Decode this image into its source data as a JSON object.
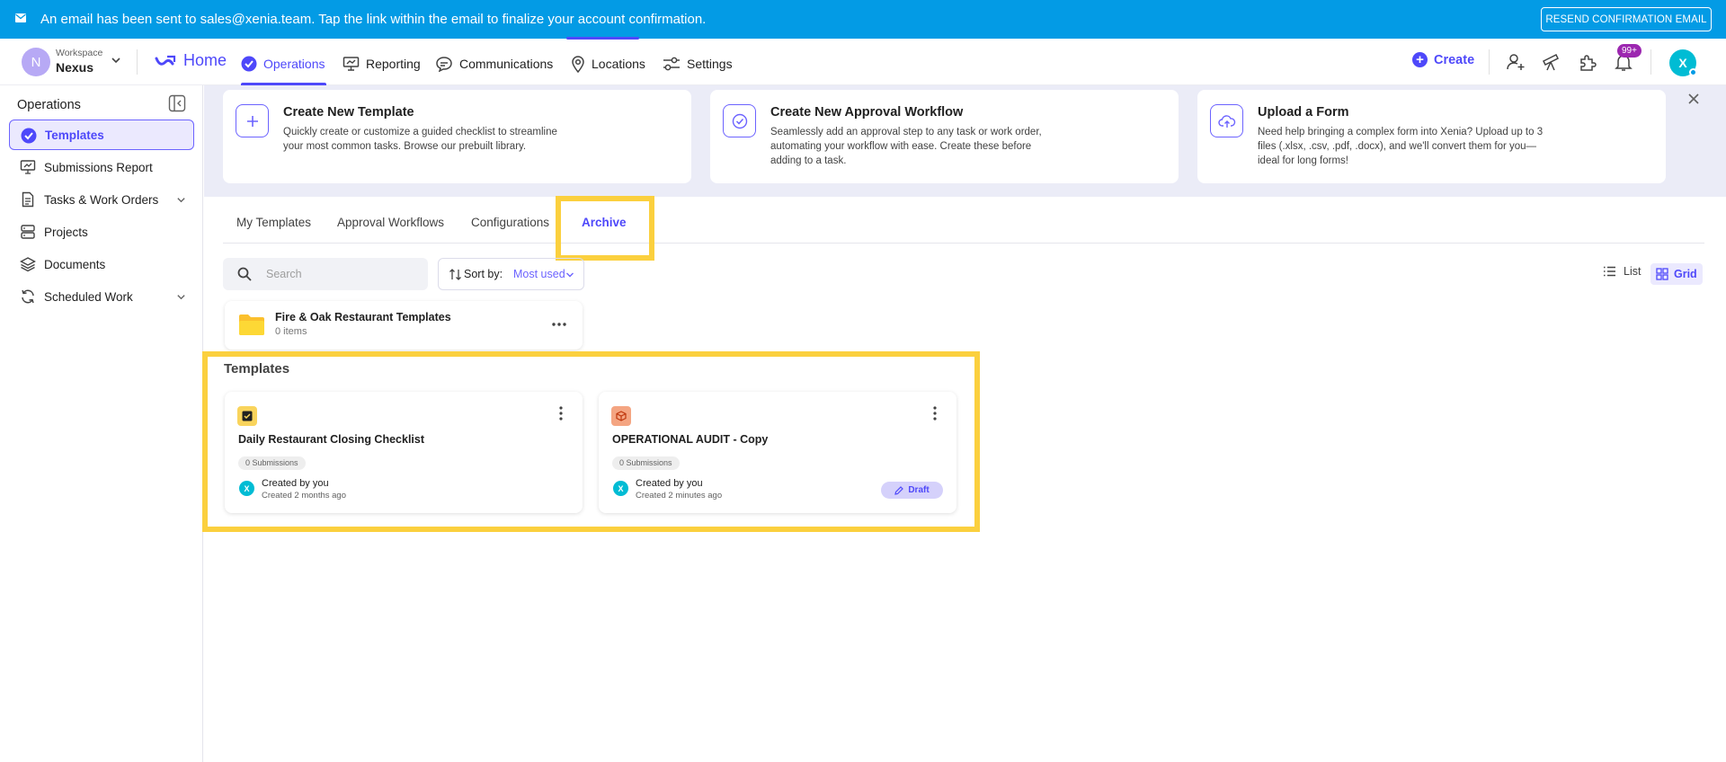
{
  "banner": {
    "message": "An email has been sent to sales@xenia.team. Tap the link within the email to finalize your account confirmation.",
    "resend_label": "RESEND CONFIRMATION EMAIL"
  },
  "workspace": {
    "avatar_letter": "N",
    "label": "Workspace",
    "name": "Nexus"
  },
  "nav": {
    "home": "Home",
    "items": [
      {
        "label": "Operations",
        "icon": "check-circle-icon",
        "active": true
      },
      {
        "label": "Reporting",
        "icon": "presentation-chart-icon"
      },
      {
        "label": "Communications",
        "icon": "chat-bubble-icon"
      },
      {
        "label": "Locations",
        "icon": "map-pin-icon"
      },
      {
        "label": "Settings",
        "icon": "sliders-icon"
      }
    ],
    "create": "Create",
    "notifications_badge": "99+",
    "user_initial": "X"
  },
  "sidebar": {
    "title": "Operations",
    "items": [
      {
        "label": "Templates",
        "icon": "check-circle-icon",
        "active": true
      },
      {
        "label": "Submissions Report",
        "icon": "presentation-icon"
      },
      {
        "label": "Tasks & Work Orders",
        "icon": "document-icon",
        "expandable": true
      },
      {
        "label": "Projects",
        "icon": "stack-icon"
      },
      {
        "label": "Documents",
        "icon": "layers-icon"
      },
      {
        "label": "Scheduled Work",
        "icon": "refresh-icon",
        "expandable": true
      }
    ]
  },
  "hero": {
    "cards": [
      {
        "title": "Create New Template",
        "desc1": "Quickly create or customize a guided checklist to streamline",
        "desc2": "your most common tasks. Browse our prebuilt library.",
        "desc3": ""
      },
      {
        "title": "Create New Approval Workflow",
        "desc1": "Seamlessly add an approval step to any task or work order,",
        "desc2": "automating your workflow with ease. Create these before",
        "desc3": "adding to a task."
      },
      {
        "title": "Upload a Form",
        "desc1": "Need help bringing a complex form into Xenia? Upload up to 3",
        "desc2": "files (.xlsx, .csv, .pdf, .docx), and we'll convert them for you—",
        "desc3": "ideal for long forms!"
      }
    ]
  },
  "tabs": [
    "My Templates",
    "Approval Workflows",
    "Configurations",
    "Archive"
  ],
  "toolbar": {
    "search_placeholder": "Search",
    "sort_label": "Sort by:",
    "sort_value": "Most used",
    "view_list": "List",
    "view_grid": "Grid"
  },
  "folder": {
    "name": "Fire & Oak Restaurant Templates",
    "count": "0 items"
  },
  "section_title": "Templates",
  "templates": [
    {
      "name": "Daily Restaurant Closing Checklist",
      "submissions": "0 Submissions",
      "created_by": "Created by you",
      "created_ago": "Created 2 months ago",
      "avatar": "X",
      "icon_color": "#f9d45c"
    },
    {
      "name": "OPERATIONAL AUDIT - Copy",
      "submissions": "0 Submissions",
      "created_by": "Created by you",
      "created_ago": "Created 2 minutes ago",
      "avatar": "X",
      "icon_color": "#f4a582",
      "status": "Draft"
    }
  ],
  "colors": {
    "accent": "#4e48fa",
    "banner": "#039be5",
    "highlight": "#fbd03e"
  }
}
